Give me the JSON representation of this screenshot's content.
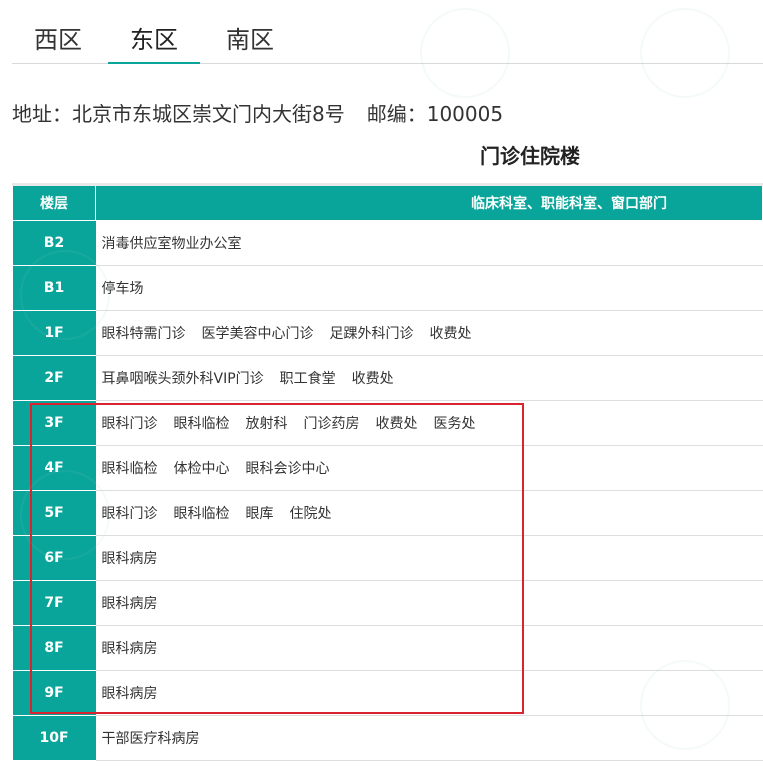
{
  "tabs": [
    "西区",
    "东区",
    "南区"
  ],
  "active_tab": 1,
  "address": {
    "address_text": "地址：北京市东城区崇文门内大街8号",
    "postcode_text": "邮编：100005"
  },
  "building_title": "门诊住院楼",
  "table": {
    "headers": {
      "floor": "楼层",
      "depts": "临床科室、职能科室、窗口部门"
    },
    "rows": [
      {
        "floor": "B2",
        "depts": [
          "消毒供应室物业办公室"
        ]
      },
      {
        "floor": "B1",
        "depts": [
          "停车场"
        ]
      },
      {
        "floor": "1F",
        "depts": [
          "眼科特需门诊",
          "医学美容中心门诊",
          "足踝外科门诊",
          "收费处"
        ]
      },
      {
        "floor": "2F",
        "depts": [
          "耳鼻咽喉头颈外科VIP门诊",
          "职工食堂",
          "收费处"
        ]
      },
      {
        "floor": "3F",
        "depts": [
          "眼科门诊",
          "眼科临检",
          "放射科",
          "门诊药房",
          "收费处",
          "医务处"
        ]
      },
      {
        "floor": "4F",
        "depts": [
          "眼科临检",
          "体检中心",
          "眼科会诊中心"
        ]
      },
      {
        "floor": "5F",
        "depts": [
          "眼科门诊",
          "眼科临检",
          "眼库",
          "住院处"
        ]
      },
      {
        "floor": "6F",
        "depts": [
          "眼科病房"
        ]
      },
      {
        "floor": "7F",
        "depts": [
          "眼科病房"
        ]
      },
      {
        "floor": "8F",
        "depts": [
          "眼科病房"
        ]
      },
      {
        "floor": "9F",
        "depts": [
          "眼科病房"
        ]
      },
      {
        "floor": "10F",
        "depts": [
          "干部医疗科病房"
        ]
      }
    ]
  },
  "colors": {
    "accent": "#0aa59a",
    "highlight_border": "#d9232e"
  }
}
